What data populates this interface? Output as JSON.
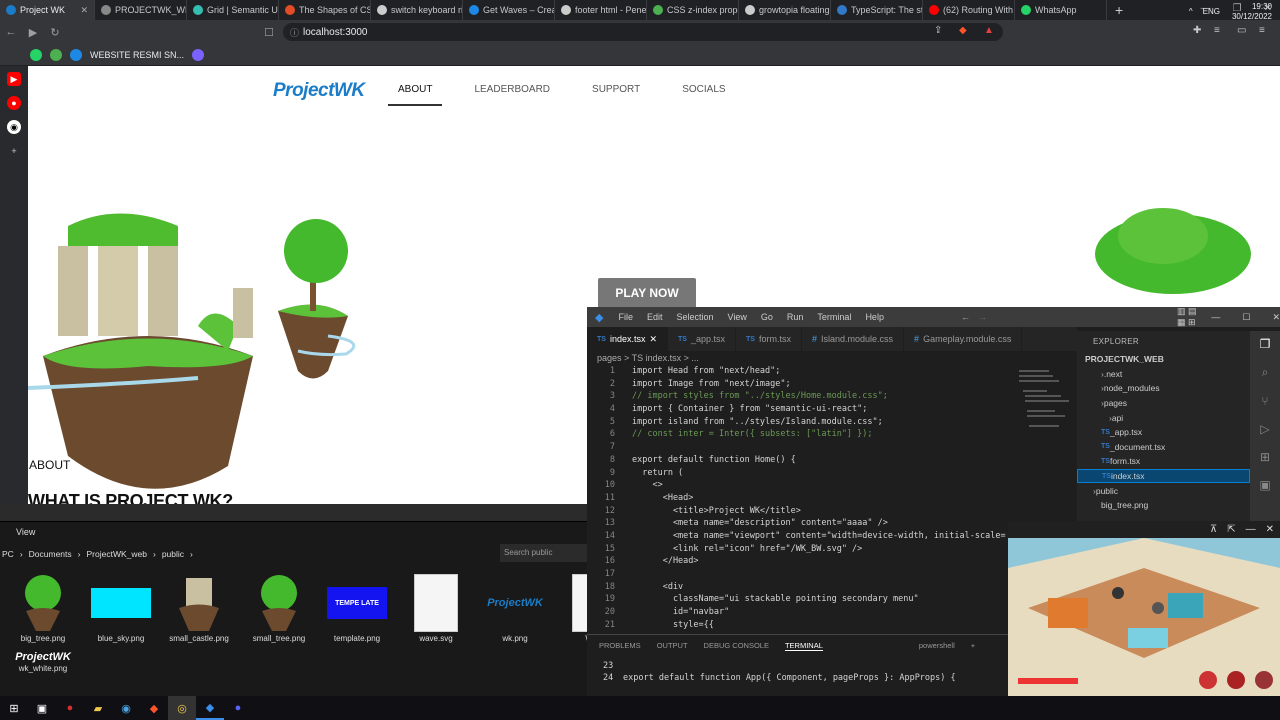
{
  "browser": {
    "tabs": [
      {
        "label": "Project WK",
        "color": "#1b7cc7",
        "active": true
      },
      {
        "label": "PROJECTWK_WEB",
        "color": "#888"
      },
      {
        "label": "Grid | Semantic UI",
        "color": "#35bdb2"
      },
      {
        "label": "The Shapes of CSS",
        "color": "#e34c26"
      },
      {
        "label": "switch keyboard ri...",
        "color": "#ccc"
      },
      {
        "label": "Get Waves – Create...",
        "color": "#1e88e5"
      },
      {
        "label": "footer html - Penel...",
        "color": "#ccc"
      },
      {
        "label": "CSS z-index prope...",
        "color": "#4caf50"
      },
      {
        "label": "growtopia floating",
        "color": "#ccc"
      },
      {
        "label": "TypeScript: The sta...",
        "color": "#3178c6"
      },
      {
        "label": "(62) Routing With I...",
        "color": "#ff0000"
      },
      {
        "label": "WhatsApp",
        "color": "#25d366"
      }
    ],
    "url": "localhost:3000",
    "bookmark": "WEBSITE RESMI SN..."
  },
  "site": {
    "logo": "ProjectWK",
    "menu": [
      "ABOUT",
      "LEADERBOARD",
      "SUPPORT",
      "SOCIALS"
    ],
    "play_button": "PLAY NOW",
    "about_label": "ABOUT",
    "heading": "WHAT IS PROJECT WK?"
  },
  "vscode": {
    "menu": [
      "File",
      "Edit",
      "Selection",
      "View",
      "Go",
      "Run",
      "Terminal",
      "Help"
    ],
    "tabs": [
      "index.tsx",
      "_app.tsx",
      "form.tsx",
      "Island.module.css",
      "Gameplay.module.css"
    ],
    "breadcrumb": "pages > TS index.tsx > ...",
    "code": [
      "import Head from \"next/head\";",
      "import Image from \"next/image\";",
      "// import styles from \"../styles/Home.module.css\";",
      "import { Container } from \"semantic-ui-react\";",
      "import island from \"../styles/Island.module.css\";",
      "// const inter = Inter({ subsets: [\"latin\"] });",
      "",
      "export default function Home() {",
      "  return (",
      "    <>",
      "      <Head>",
      "        <title>Project WK</title>",
      "        <meta name=\"description\" content=\"aaaa\" />",
      "        <meta name=\"viewport\" content=\"width=device-width, initial-scale=",
      "        <link rel=\"icon\" href=\"/WK_BW.svg\" />",
      "      </Head>",
      "",
      "      <div",
      "        className=\"ui stackable pointing secondary menu\"",
      "        id=\"navbar\"",
      "        style={{"
    ],
    "explorer_title": "EXPLORER",
    "project": "PROJECTWK_WEB",
    "tree": [
      ".next",
      "node_modules",
      "pages",
      "api",
      "_app.tsx",
      "_document.tsx",
      "form.tsx",
      "index.tsx",
      "public",
      "big_tree.png"
    ],
    "panel_tabs": [
      "PROBLEMS",
      "OUTPUT",
      "DEBUG CONSOLE",
      "TERMINAL"
    ],
    "terminal_lines": [
      {
        "n": "23",
        "t": ""
      },
      {
        "n": "24",
        "t": "export default function App({ Component, pageProps }: AppProps) {"
      }
    ],
    "shell": "powershell"
  },
  "file_explorer": {
    "view_label": "View",
    "path": [
      "PC",
      "Documents",
      "ProjectWK_web",
      "public"
    ],
    "search_placeholder": "Search public",
    "files": [
      "big_tree.png",
      "blue_sky.png",
      "small_castle.png",
      "small_tree.png",
      "template.png",
      "wave.svg",
      "wk.png",
      "WK_",
      "wk_white.png"
    ],
    "template_text": "TEMPE LATE",
    "wk_text": "ProjectWK"
  },
  "taskbar": {
    "lang": "ENG",
    "time": "19:30",
    "date": "30/12/2022"
  }
}
